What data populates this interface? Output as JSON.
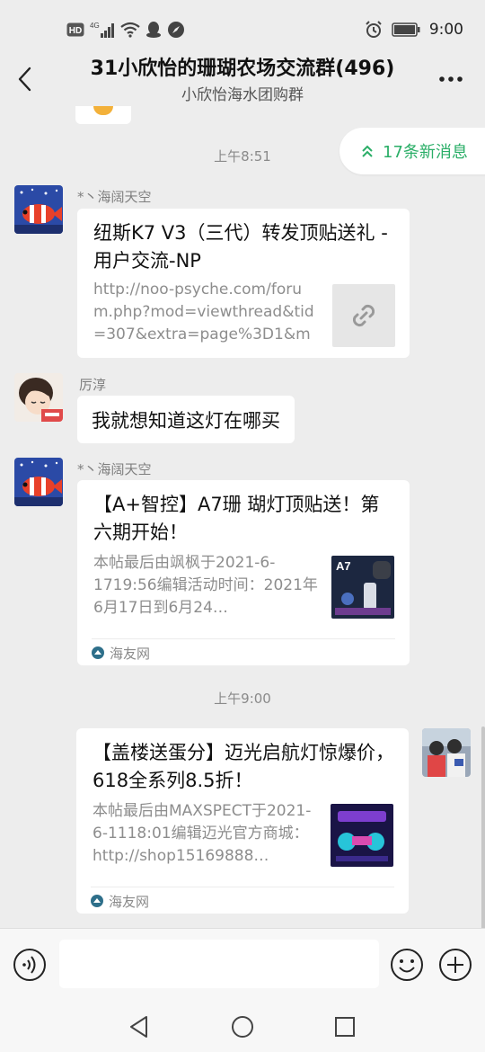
{
  "status_bar": {
    "hd_badge": "HD",
    "network": "4G",
    "time": "9:00",
    "icons": [
      "hd-icon",
      "signal-icon",
      "wifi-icon",
      "qq-icon",
      "compass-icon",
      "alarm-icon",
      "battery-icon"
    ]
  },
  "nav": {
    "title": "31小欣怡的珊瑚农场交流群(496)",
    "subtitle": "小欣怡海水团购群",
    "back_icon": "back-arrow-icon",
    "more_icon": "more-dots-icon"
  },
  "new_messages": {
    "label": "17条新消息",
    "color": "#2aae67"
  },
  "messages": [
    {
      "kind": "time",
      "text": "上午8:51"
    },
    {
      "kind": "link_card",
      "sender": "*丶海阔天空",
      "title": "纽斯K7 V3（三代）转发顶贴送礼 - 用户交流-NP",
      "desc": "http://noo-psyche.com/forum.php?mod=viewthread&tid=307&extra=page%3D1&mo…",
      "thumb_icon": "link-icon"
    },
    {
      "kind": "text",
      "sender": "厉淳",
      "text": "我就想知道这灯在哪买"
    },
    {
      "kind": "article_card",
      "sender": "*丶海阔天空",
      "title": "【A+智控】A7珊 瑚灯顶贴送！第六期开始！",
      "desc": "本帖最后由飒枫于2021-6-1719:56编辑活动时间：2021年6月17日到6月24…",
      "thumb_label": "A7",
      "source": "海友网"
    },
    {
      "kind": "time",
      "text": "上午9:00"
    },
    {
      "kind": "article_card",
      "sender": "",
      "self": true,
      "title": "【盖楼送蛋分】迈光启航灯惊爆价，618全系列8.5折！",
      "desc": "本帖最后由MAXSPECT于2021-6-1118:01编辑迈光官方商城：http://shop15169888…",
      "source": "海友网"
    }
  ],
  "input_bar": {
    "placeholder": "",
    "voice_icon": "voice-icon",
    "emoji_icon": "emoji-icon",
    "plus_icon": "plus-icon"
  },
  "system_nav": {
    "icons": [
      "back-triangle-icon",
      "home-circle-icon",
      "recents-square-icon"
    ]
  }
}
